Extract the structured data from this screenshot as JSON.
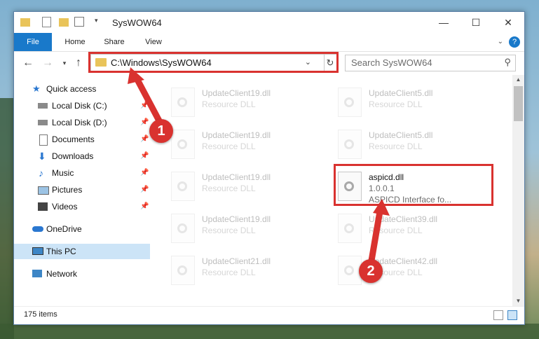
{
  "window": {
    "title": "SysWOW64",
    "minimize": "—",
    "maximize": "☐",
    "close": "✕"
  },
  "ribbon": {
    "tabs": [
      "File",
      "Home",
      "Share",
      "View"
    ],
    "help": "?"
  },
  "address_bar": {
    "path": "C:\\Windows\\SysWOW64"
  },
  "search": {
    "placeholder": "Search SysWOW64"
  },
  "sidebar": {
    "items": [
      {
        "label": "Quick access"
      },
      {
        "label": "Local Disk (C:)"
      },
      {
        "label": "Local Disk (D:)"
      },
      {
        "label": "Documents"
      },
      {
        "label": "Downloads"
      },
      {
        "label": "Music"
      },
      {
        "label": "Pictures"
      },
      {
        "label": "Videos"
      },
      {
        "label": "OneDrive"
      },
      {
        "label": "This PC"
      },
      {
        "label": "Network"
      }
    ]
  },
  "files": [
    {
      "name": "UpdateClient19.dll",
      "sub": "Resource DLL"
    },
    {
      "name": "UpdateClient5.dll",
      "sub": "Resource DLL"
    },
    {
      "name": "UpdateClient19.dll",
      "sub": "Resource DLL"
    },
    {
      "name": "UpdateClient5.dll",
      "sub": "Resource DLL"
    },
    {
      "name": "UpdateClient19.dll",
      "sub": "Resource DLL"
    },
    {
      "name": "aspicd.dll",
      "version": "1.0.0.1",
      "desc": "ASPICD Interface fo..."
    },
    {
      "name": "UpdateClient19.dll",
      "sub": "Resource DLL"
    },
    {
      "name": "UpdateClient39.dll",
      "sub": "Resource DLL"
    },
    {
      "name": "UpdateClient21.dll",
      "sub": "Resource DLL"
    },
    {
      "name": "UpdateClient42.dll",
      "sub": "Resource DLL"
    }
  ],
  "status": {
    "item_count": "175 items"
  },
  "annotations": {
    "step1": "1",
    "step2": "2"
  },
  "colors": {
    "accent": "#1979ca",
    "highlight": "#d9322f",
    "selection": "#cce4f7"
  }
}
